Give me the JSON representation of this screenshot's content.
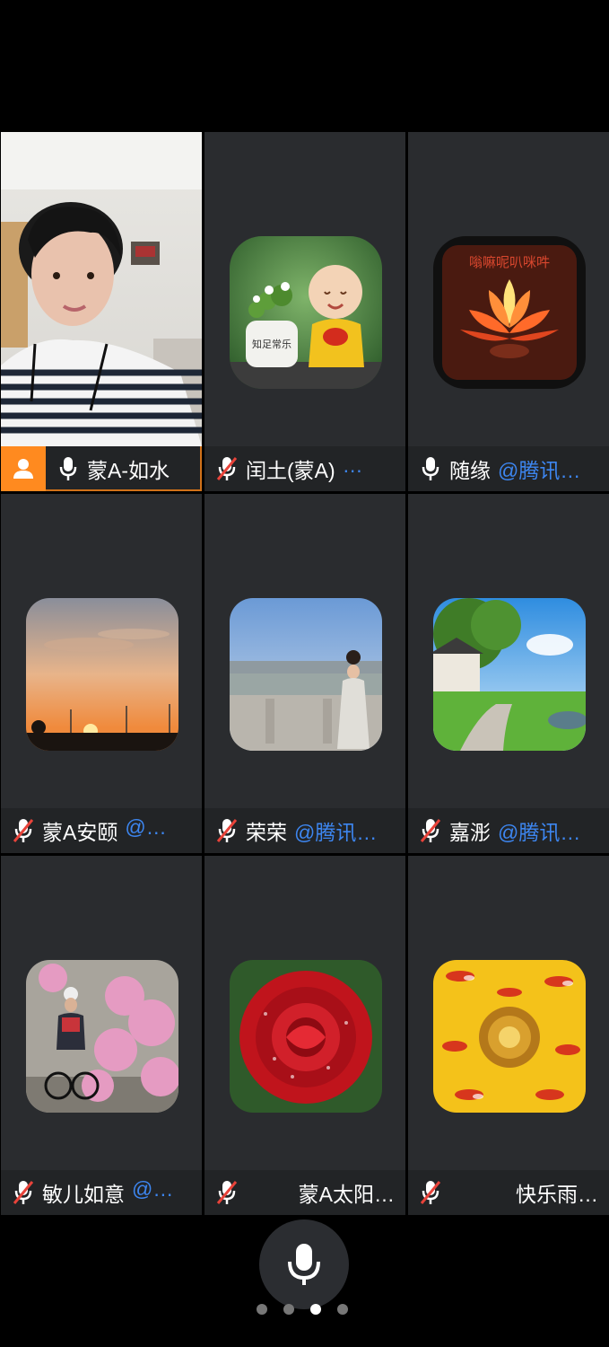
{
  "participants": [
    {
      "name": "蒙A-如水",
      "tag": "",
      "muted": false,
      "host": true,
      "speaking": true
    },
    {
      "name": "闰土(蒙A)",
      "tag": "…",
      "muted": true,
      "host": false
    },
    {
      "name": "随缘",
      "tag": "@腾讯…",
      "muted": false,
      "host": false
    },
    {
      "name": "蒙A安颐",
      "tag": "@…",
      "muted": true,
      "host": false
    },
    {
      "name": "荣荣",
      "tag": "@腾讯…",
      "muted": true,
      "host": false
    },
    {
      "name": "嘉浵",
      "tag": "@腾讯…",
      "muted": true,
      "host": false
    },
    {
      "name": "敏儿如意",
      "tag": "@…",
      "muted": true,
      "host": false
    },
    {
      "name": "蒙A太阳…",
      "tag": "",
      "muted": true,
      "host": false
    },
    {
      "name": "快乐雨…",
      "tag": "",
      "muted": true,
      "host": false
    }
  ],
  "avatar_text": {
    "pot": "知足常乐",
    "lotus": "嗡嘛呢叭咪吽"
  },
  "controls": {
    "mic_icon": "microphone-icon",
    "pages": 4,
    "active_page": 3
  },
  "colors": {
    "host_badge": "#ff8a1f",
    "speaking_border": "#ff8a1f",
    "tag_blue": "#3d86f0",
    "tile_bg": "#2a2c2f"
  }
}
